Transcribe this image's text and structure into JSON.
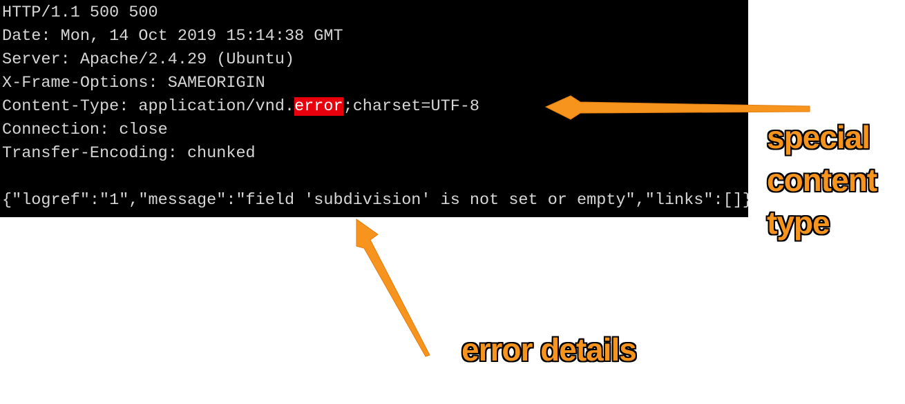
{
  "terminal": {
    "lines": [
      "HTTP/1.1 500 500",
      "Date: Mon, 14 Oct 2019 15:14:38 GMT",
      "Server: Apache/2.4.29 (Ubuntu)",
      "X-Frame-Options: SAMEORIGIN",
      "",
      "Connection: close",
      "Transfer-Encoding: chunked",
      "",
      "{\"logref\":\"1\",\"message\":\"field 'subdivision' is not set or empty\",\"links\":[]}"
    ],
    "content_type_prefix": "Content-Type: application/vnd.",
    "content_type_highlight": "error",
    "content_type_suffix": ";charset=UTF-8"
  },
  "annotations": {
    "content_type_label": [
      "special",
      "content",
      "type"
    ],
    "error_details_label": "error details"
  },
  "colors": {
    "annotation": "#f7941d",
    "highlight": "#e8000d",
    "terminal_bg": "#000000"
  }
}
